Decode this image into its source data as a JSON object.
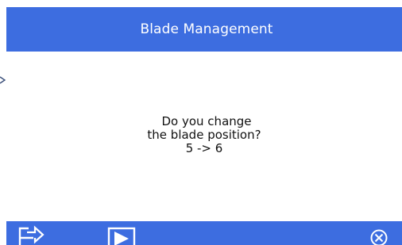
{
  "dialog": {
    "title": "Blade Management",
    "message_lines": [
      "Do you change",
      "the blade position?",
      "5 -> 6"
    ]
  },
  "toolbar": {
    "buttons": [
      {
        "icon": "exit-arrow-icon"
      },
      {
        "icon": "play-icon"
      },
      {
        "icon": "cancel-circle-x-icon"
      }
    ]
  },
  "colors": {
    "accent": "#3d6de0",
    "background": "#ffffff",
    "text": "#111111",
    "icon": "#ffffff"
  }
}
